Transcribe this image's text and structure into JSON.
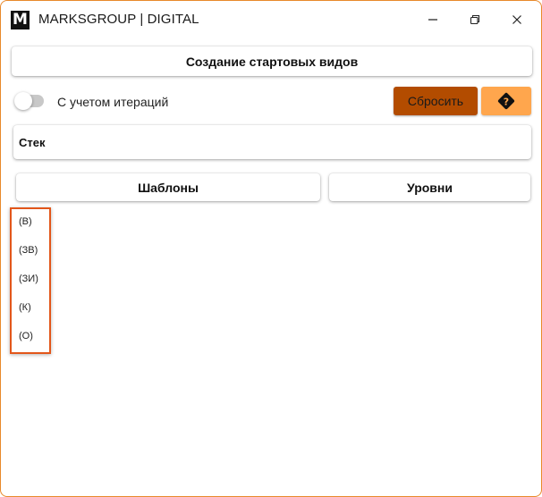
{
  "window": {
    "logo_letter": "M",
    "title": "MARKSGROUP | DIGITAL"
  },
  "header": {
    "button_label": "Создание стартовых видов"
  },
  "options": {
    "toggle_label": "С учетом итераций",
    "toggle_on": false,
    "reset_label": "Сбросить",
    "help_icon": "question-diamond-icon"
  },
  "stack": {
    "label": "Стек"
  },
  "tabs": [
    {
      "label": "Шаблоны"
    },
    {
      "label": "Уровни"
    }
  ],
  "list": {
    "items": [
      "(В)",
      "(ЗВ)",
      "(ЗИ)",
      "(К)",
      "(О)"
    ]
  },
  "colors": {
    "window_border": "#e8892b",
    "reset_bg": "#b34c00",
    "help_bg": "#ffa64d",
    "highlight_border": "#e2561a"
  }
}
